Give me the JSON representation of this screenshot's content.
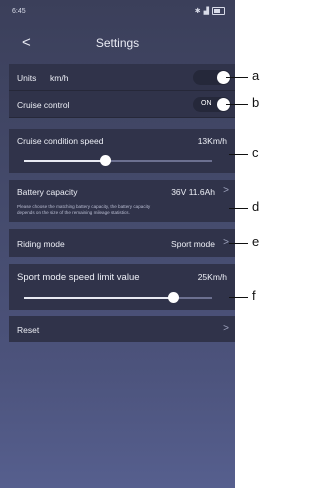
{
  "status_bar": {
    "time": "6:45",
    "icons": [
      "bluetooth-icon",
      "signal-icon",
      "battery-icon"
    ]
  },
  "header": {
    "back_label": "<",
    "title": "Settings"
  },
  "units": {
    "label": "Units",
    "value": "km/h",
    "toggle_state": "off"
  },
  "cruise_control": {
    "label": "Cruise control",
    "toggle_text": "ON",
    "toggle_state": "on"
  },
  "cruise_speed": {
    "label": "Cruise condition speed",
    "value": "13Km/h",
    "slider_fraction": 0.43
  },
  "battery": {
    "label": "Battery capacity",
    "value": "36V 11.6Ah",
    "note_line1": "Please choose the matching battery capacity, the battery capacity",
    "note_line2": "depends on the size of the remaining mileage statistics."
  },
  "riding_mode": {
    "label": "Riding mode",
    "value": "Sport mode"
  },
  "speed_limit": {
    "label": "Sport mode speed limit value",
    "value": "25Km/h",
    "slider_fraction": 0.79
  },
  "reset": {
    "label": "Reset"
  },
  "callouts": [
    "a",
    "b",
    "c",
    "d",
    "e",
    "f"
  ],
  "colors": {
    "background_top": "#3b3f5a",
    "background_bottom": "#565f8e",
    "row": "#30334a",
    "thumb": "#ffffff"
  }
}
